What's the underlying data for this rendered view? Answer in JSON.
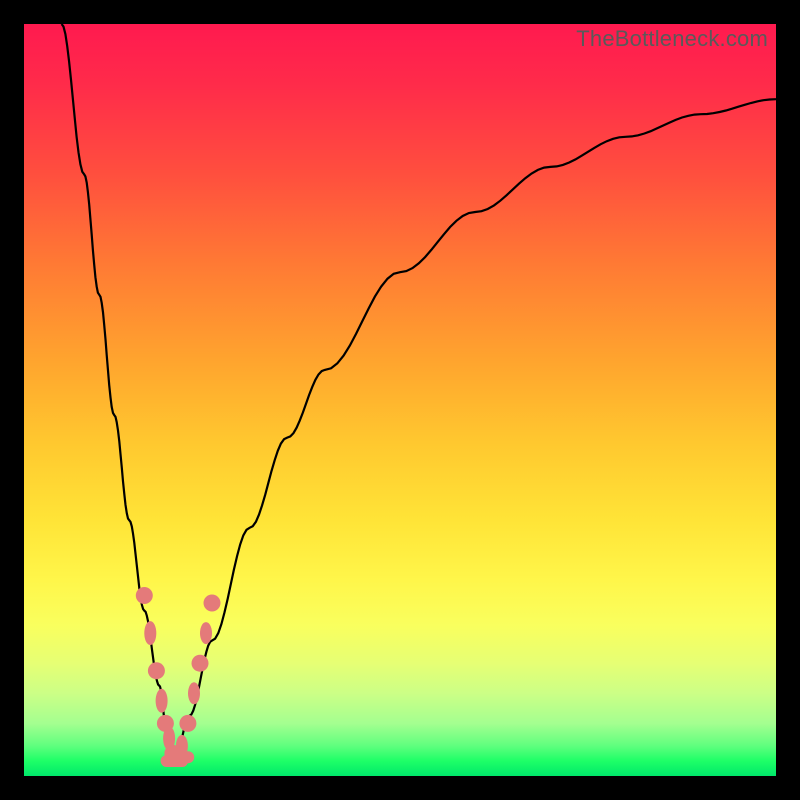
{
  "watermark": "TheBottleneck.com",
  "colors": {
    "frame": "#000000",
    "gradient_top": "#ff1a4f",
    "gradient_bottom": "#00e86a",
    "curve": "#000000",
    "markers": "#e47a7a"
  },
  "chart_data": {
    "type": "line",
    "title": "",
    "xlabel": "",
    "ylabel": "",
    "xlim": [
      0,
      100
    ],
    "ylim": [
      0,
      100
    ],
    "notes": "V-shaped bottleneck curve. Values below are estimated (x, y-percent-from-bottom) sampled from the rendered paths. Lower y means closer to the green (good) zone. Minimum (~0) occurs near x≈20.",
    "series": [
      {
        "name": "left-branch",
        "x": [
          5,
          8,
          10,
          12,
          14,
          16,
          18,
          19,
          20
        ],
        "values": [
          100,
          80,
          64,
          48,
          34,
          22,
          12,
          6,
          2
        ]
      },
      {
        "name": "right-branch",
        "x": [
          20,
          22,
          25,
          30,
          35,
          40,
          50,
          60,
          70,
          80,
          90,
          100
        ],
        "values": [
          2,
          8,
          18,
          33,
          45,
          54,
          67,
          75,
          81,
          85,
          88,
          90
        ]
      }
    ],
    "markers": {
      "name": "highlighted-points",
      "comment": "Salmon dots/pills clustered near the valley on both branches",
      "points_left": [
        {
          "x": 16.0,
          "y": 24
        },
        {
          "x": 16.8,
          "y": 19
        },
        {
          "x": 17.6,
          "y": 14
        },
        {
          "x": 18.3,
          "y": 10
        },
        {
          "x": 18.8,
          "y": 7
        },
        {
          "x": 19.3,
          "y": 5
        },
        {
          "x": 19.8,
          "y": 3
        }
      ],
      "points_right": [
        {
          "x": 21.0,
          "y": 4
        },
        {
          "x": 21.8,
          "y": 7
        },
        {
          "x": 22.6,
          "y": 11
        },
        {
          "x": 23.4,
          "y": 15
        },
        {
          "x": 24.2,
          "y": 19
        },
        {
          "x": 25.0,
          "y": 23
        }
      ],
      "bottom_pills": [
        {
          "x": 19.5,
          "y": 2
        },
        {
          "x": 20.5,
          "y": 2
        },
        {
          "x": 21.3,
          "y": 2.5
        }
      ]
    }
  }
}
